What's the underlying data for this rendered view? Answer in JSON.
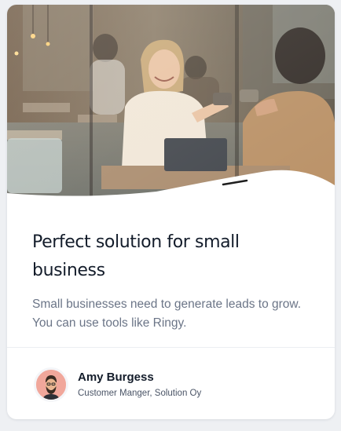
{
  "card": {
    "image_alt": "Coffee shop meeting photo",
    "title": "Perfect solution for small business",
    "description": "Small businesses need to generate leads to grow. You can use tools like Ringy.",
    "author": {
      "name": "Amy Burgess",
      "role": "Customer Manger, Solution Oy",
      "avatar_icon": "bearded-man-avatar-icon"
    }
  },
  "colors": {
    "title": "#141d2b",
    "description": "#6b7587",
    "avatar_bg": "#f1a79b",
    "card_bg": "#ffffff",
    "page_bg": "#eef0f3"
  }
}
